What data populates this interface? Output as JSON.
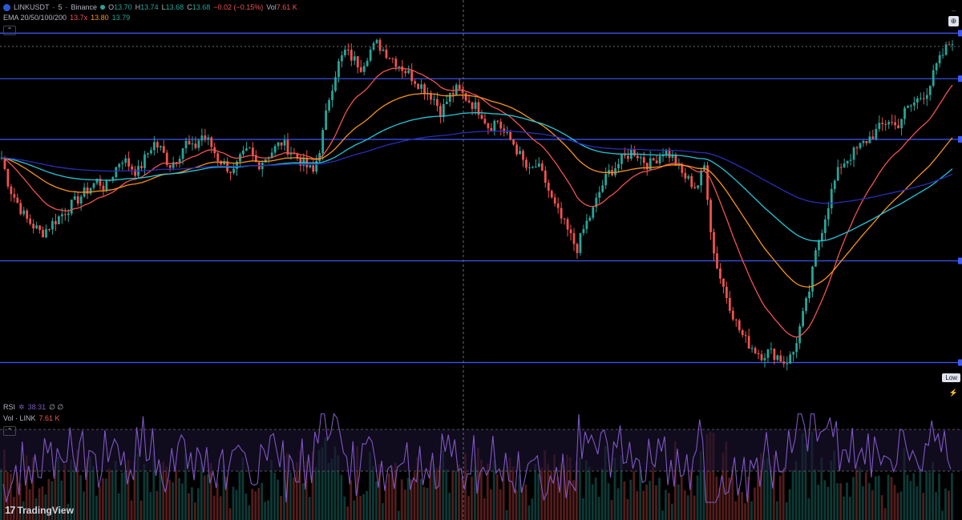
{
  "header": {
    "symbol": "LINKUSDT",
    "interval": "5",
    "exchange": "Binance",
    "title_sep": "·",
    "open_label": "O",
    "open": "13.70",
    "high_label": "H",
    "high": "13.74",
    "low_label": "L",
    "low": "13.68",
    "close_label": "C",
    "close": "13.68",
    "change": "−0.02 (−0.15%)",
    "vol_label": "Vol",
    "vol": "7.61 K"
  },
  "ema": {
    "label": "EMA 20/50/100/200",
    "v1": "13.7x",
    "v2": "13.80",
    "v3": "13.79"
  },
  "rsi": {
    "label": "RSI",
    "value": "38.31",
    "extra": "∅ ∅"
  },
  "volume": {
    "label": "Vol · LINK",
    "value": "7.61 K"
  },
  "tags": {
    "low": "Low"
  },
  "brand": {
    "logo": "17",
    "name": "TradingView"
  },
  "colors": {
    "background": "#000000",
    "up": "#26a69a",
    "down": "#ef5350",
    "ema20": "#ef5350",
    "ema50": "#f7931a",
    "ema100": "#26c6da",
    "ema200": "#2a2eb8",
    "hline": "#3d5afe",
    "rsi": "#7e57c2"
  },
  "chart_data": {
    "type": "candlestick",
    "symbol": "LINKUSDT",
    "timeframe": "5",
    "horizontal_levels": [
      13.72,
      13.42,
      13.02,
      12.22,
      11.55
    ],
    "price_close": [
      12.9,
      12.7,
      12.6,
      12.5,
      12.45,
      12.4,
      12.45,
      12.5,
      12.55,
      12.6,
      12.65,
      12.7,
      12.75,
      12.7,
      12.8,
      12.9,
      12.85,
      12.8,
      12.9,
      13.0,
      12.95,
      12.85,
      12.9,
      13.0,
      12.95,
      13.05,
      13.0,
      12.9,
      12.85,
      12.8,
      12.9,
      12.95,
      12.85,
      12.9,
      12.95,
      13.0,
      12.95,
      12.9,
      12.85,
      12.8,
      13.0,
      13.3,
      13.5,
      13.6,
      13.55,
      13.5,
      13.6,
      13.65,
      13.6,
      13.55,
      13.5,
      13.45,
      13.4,
      13.35,
      13.3,
      13.2,
      13.3,
      13.35,
      13.3,
      13.25,
      13.2,
      13.1,
      13.15,
      13.05,
      13.0,
      12.9,
      12.8,
      12.85,
      12.75,
      12.6,
      12.5,
      12.4,
      12.3,
      12.45,
      12.55,
      12.7,
      12.8,
      12.85,
      12.9,
      12.95,
      12.9,
      12.85,
      12.9,
      12.95,
      12.9,
      12.8,
      12.75,
      12.7,
      12.85,
      12.3,
      12.1,
      11.95,
      11.8,
      11.7,
      11.65,
      11.6,
      11.62,
      11.6,
      11.55,
      11.6,
      11.8,
      12.0,
      12.3,
      12.5,
      12.7,
      12.85,
      12.9,
      12.95,
      13.0,
      13.05,
      13.1,
      13.15,
      13.1,
      13.2,
      13.25,
      13.3,
      13.35,
      13.5,
      13.6,
      13.68
    ]
  }
}
